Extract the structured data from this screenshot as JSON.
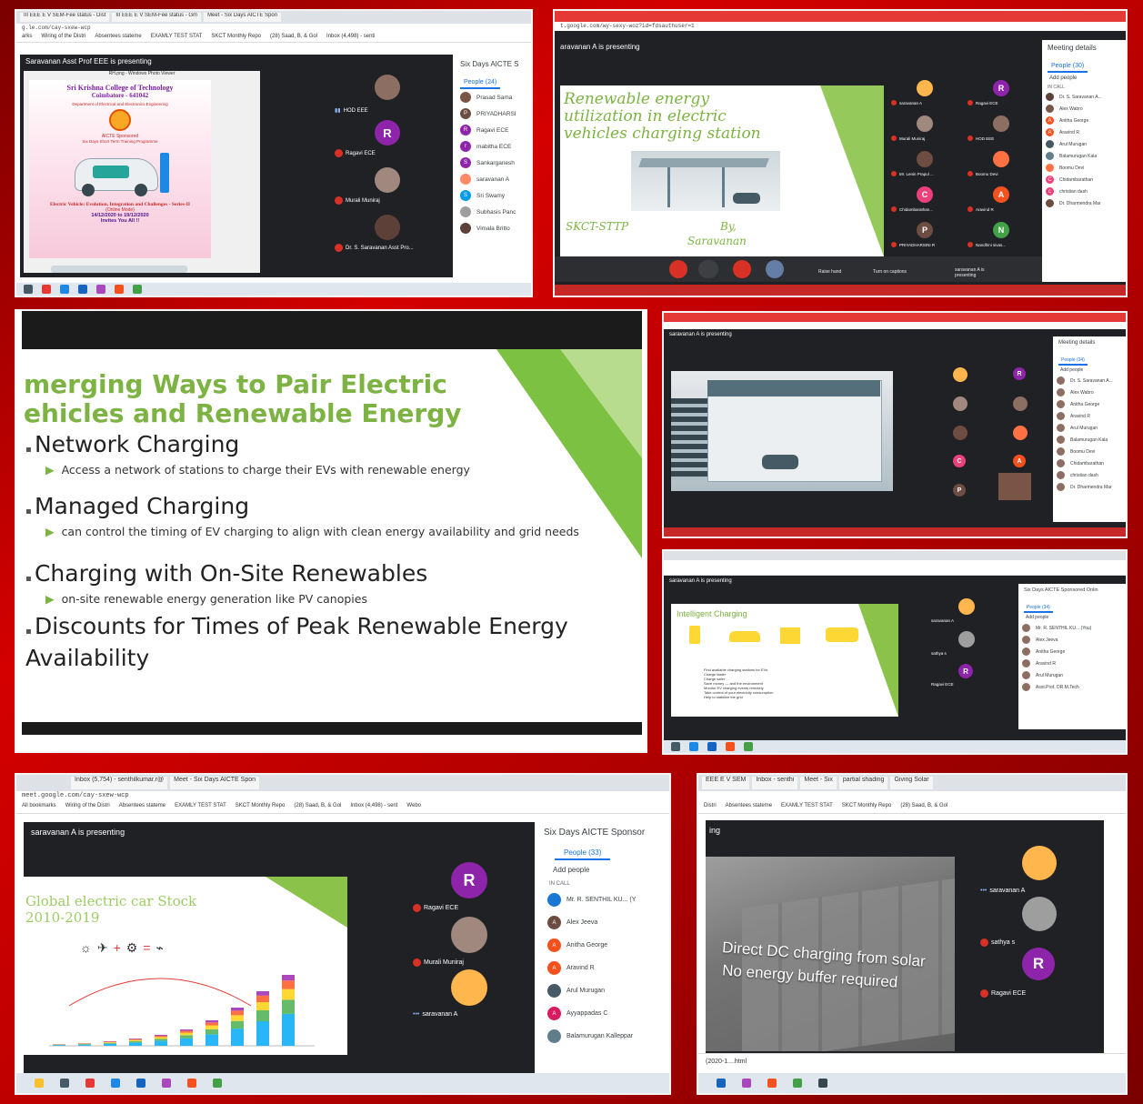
{
  "p1": {
    "tabs": [
      "III EEE E V SEM-Fee status - Dist",
      "III EEE E V SEM-Fee status - Gm",
      "Meet - Six Days AICTE Spon"
    ],
    "url": "g.le.com/cay-sxew-wcp",
    "bookmarks": [
      "arks",
      "Wiring of the Distri",
      "Absentees stateme",
      "EXAMLY TEST STAT",
      "SKCT Monthly Repo",
      "(28) Saad, B, & Gol",
      "Inbox (4,498) - senti"
    ],
    "presenting": "Saravanan Asst Prof EEE is presenting",
    "viewer_title": "RH.png - Windows Photo Viewer",
    "poster": {
      "college": "Sri Krishna College of Technology",
      "city": "Coimbatore - 641042",
      "dept": "Department of Electrical and Electronics Engineering",
      "aicte": "AICTE Sponsored",
      "program": "Six Days Short Term Training Programme",
      "topic": "Electric Vehicle: Evolution, Integration and Challenges - Series-II",
      "mode": "(Online Mode)",
      "dates": "14/12/2020 to 19/12/2020",
      "invite": "Invites You All !!"
    },
    "tiles": [
      {
        "name": "HOD EEE",
        "letter": "",
        "color": "#8d6e63"
      },
      {
        "name": "Ragavi ECE",
        "letter": "R",
        "color": "#8e24aa"
      },
      {
        "name": "Murali Muniraj",
        "letter": "",
        "color": "#a1887f"
      },
      {
        "name": "Dr. S. Saravanan Asst Pro...",
        "letter": "",
        "color": "#5d4037"
      }
    ],
    "people_title": "Six Days AICTE S",
    "people_tab": "People (24)",
    "people": [
      {
        "name": "Prasad Sama",
        "letter": "",
        "color": "#795548"
      },
      {
        "name": "PRIYADHARSI",
        "letter": "P",
        "color": "#6d4c41"
      },
      {
        "name": "Ragavi ECE",
        "letter": "R",
        "color": "#8e24aa"
      },
      {
        "name": "mabitha ECE",
        "letter": "r",
        "color": "#8e24aa"
      },
      {
        "name": "Sankarganesh",
        "letter": "S",
        "color": "#8e24aa"
      },
      {
        "name": "saravanan A",
        "letter": "",
        "color": "#ff8a65"
      },
      {
        "name": "Sri Swamy",
        "letter": "S",
        "color": "#039be5"
      },
      {
        "name": "Subhasis Panc",
        "letter": "",
        "color": "#9e9e9e"
      },
      {
        "name": "Vimala Britto",
        "letter": "",
        "color": "#5d4037"
      }
    ]
  },
  "p2": {
    "url": "t.google.com/wy-sexy-woz?id=fdsauthuser=1",
    "presenting": "aravanan A is presenting",
    "slide_title": "Renewable energy utilization in electric vehicles charging station",
    "footer_left": "SKCT-STTP",
    "footer_by": "By,",
    "footer_name": "Saravanan",
    "tiles": [
      {
        "name": "saravanan A",
        "letter": "",
        "color": "#ffb74d"
      },
      {
        "name": "Ragavi ECE",
        "letter": "R",
        "color": "#8e24aa"
      },
      {
        "name": "Murali Muniraj",
        "letter": "",
        "color": "#a1887f"
      },
      {
        "name": "HOD EEE",
        "letter": "",
        "color": "#8d6e63"
      },
      {
        "name": "Mr. Lenin Prapul ...",
        "letter": "",
        "color": "#6d4c41"
      },
      {
        "name": "Boomu Devi",
        "letter": "",
        "color": "#ff7043"
      },
      {
        "name": "Chidambarathan...",
        "letter": "C",
        "color": "#ec407a"
      },
      {
        "name": "Aravind R",
        "letter": "A",
        "color": "#f4511e"
      },
      {
        "name": "PRIYADHARSINI R",
        "letter": "P",
        "color": "#6d4c41"
      },
      {
        "name": "Nandhini sivas...",
        "letter": "N",
        "color": "#43a047"
      }
    ],
    "meeting_details": "Meeting details",
    "people_tab": "People (30)",
    "add_people": "Add people",
    "in_call": "IN CALL",
    "people": [
      {
        "name": "Dr. S. Saravanan A...",
        "letter": "",
        "color": "#5d4037"
      },
      {
        "name": "Alex Wabro",
        "letter": "",
        "color": "#795548"
      },
      {
        "name": "Anitha George",
        "letter": "A",
        "color": "#f4511e"
      },
      {
        "name": "Aravind R",
        "letter": "A",
        "color": "#f4511e"
      },
      {
        "name": "Arul Murugan",
        "letter": "",
        "color": "#455a64"
      },
      {
        "name": "Balamurugan Kala",
        "letter": "",
        "color": "#607d8b"
      },
      {
        "name": "Boomu Devi",
        "letter": "",
        "color": "#ff7043"
      },
      {
        "name": "Chidambarathan",
        "letter": "C",
        "color": "#ec407a"
      },
      {
        "name": "christian dash",
        "letter": "c",
        "color": "#ec407a"
      },
      {
        "name": "Dr. Dharmendra Mar",
        "letter": "",
        "color": "#6d4c41"
      }
    ],
    "controls": [
      "Raise hand",
      "Turn on captions",
      "saravanan A is presenting"
    ]
  },
  "p3": {
    "title_line1": "merging Ways to Pair Electric",
    "title_line2": "ehicles and Renewable Energy",
    "items": [
      {
        "head": "Network Charging",
        "sub": "Access a network of stations to charge their EVs with renewable energy"
      },
      {
        "head": "Managed Charging",
        "sub": "can control the timing of EV charging to align with clean energy availability and grid needs"
      },
      {
        "head": "Charging with On-Site Renewables",
        "sub": "on-site renewable energy generation like PV canopies"
      },
      {
        "head": "Discounts for Times of Peak Renewable Energy Availability",
        "sub": ""
      }
    ]
  },
  "p4": {
    "presenting": "saravanan A is presenting",
    "meeting_details": "Meeting details",
    "people_tab": "People (34)",
    "add_people": "Add people",
    "people": [
      "Dr. S. Saravanan A...",
      "Alex Wabro",
      "Anitha George",
      "Aravind R",
      "Arul Murugan",
      "Balamurugan Kala",
      "Boomu Devi",
      "Chidambarathan",
      "christian dash",
      "Dr. Dharmendra Mar"
    ]
  },
  "p5": {
    "presenting": "saravanan A is presenting",
    "slide_title": "Intelligent Charging",
    "bullets": [
      "Find available charging stations for EVs",
      "Charge faster",
      "Charge safer",
      "Save money — and the environment",
      "Monitor EV charging events remotely",
      "Take control of your electricity consumption",
      "Help to stabilize the grid"
    ],
    "tiles": [
      "saravanan A",
      "sathya s",
      "Ragavi ECE"
    ],
    "people_title": "Six Days AICTE Sponsored Onlin",
    "people_tab": "People (34)",
    "add_people": "Add people",
    "people": [
      "Mr. R. SENTHIL KU... (You)",
      "Alex Jeeva",
      "Anitha George",
      "Aravind R",
      "Arul Murugan",
      "Asst.Prof. DR.M.Tech"
    ]
  },
  "p6": {
    "tabs": [
      "Inbox (5,754) - senthilkumar.r@",
      "Meet - Six Days AICTE Spon"
    ],
    "url": "meet.google.com/cay-sxew-wcp",
    "bookmarks": [
      "All bookmarks",
      "Wiring of the Distri",
      "Absentees stateme",
      "EXAMLY TEST STAT",
      "SKCT Monthly Repo",
      "(28) Saad, B, & Gol",
      "Inbox (4,498) - sent",
      "Webo"
    ],
    "presenting": "saravanan A is presenting",
    "slide_title_1": "Global electric car Stock",
    "slide_title_2": "2010-2019",
    "tiles": [
      {
        "name": "Ragavi ECE",
        "letter": "R",
        "color": "#8e24aa"
      },
      {
        "name": "Murali Muniraj",
        "letter": "",
        "color": "#a1887f"
      },
      {
        "name": "saravanan A",
        "letter": "",
        "color": "#ffb74d"
      }
    ],
    "people_title": "Six Days AICTE Sponsor",
    "people_tab": "People (33)",
    "add_people": "Add people",
    "in_call": "IN CALL",
    "people": [
      {
        "name": "Mr. R. SENTHIL KU... (Y",
        "letter": "",
        "color": "#1976d2"
      },
      {
        "name": "Alex Jeeva",
        "letter": "A",
        "color": "#6d4c41"
      },
      {
        "name": "Anitha George",
        "letter": "A",
        "color": "#f4511e"
      },
      {
        "name": "Aravind R",
        "letter": "A",
        "color": "#f4511e"
      },
      {
        "name": "Arul Murugan",
        "letter": "",
        "color": "#455a64"
      },
      {
        "name": "Ayyappadas C",
        "letter": "A",
        "color": "#d81b60"
      },
      {
        "name": "Balamurugan Kalleppar",
        "letter": "",
        "color": "#607d8b"
      }
    ]
  },
  "p7": {
    "tabs": [
      "EEE E V SEM",
      "Inbox - senthi",
      "Meet - Six",
      "partial shading",
      "Giving Solar"
    ],
    "bookmarks": [
      "Distri",
      "Absentees stateme",
      "EXAMLY TEST STAT",
      "SKCT Monthly Repo",
      "(28) Saad, B, & Gol"
    ],
    "presenting": "ing",
    "video_line1": "Direct DC charging from solar",
    "video_line2": "No energy buffer required",
    "tiles": [
      {
        "name": "saravanan A",
        "letter": "",
        "color": "#ffb74d"
      },
      {
        "name": "sathya s",
        "letter": "",
        "color": "#9e9e9e"
      },
      {
        "name": "Ragavi ECE",
        "letter": "R",
        "color": "#8e24aa"
      }
    ],
    "download": "(2020-1....html"
  }
}
